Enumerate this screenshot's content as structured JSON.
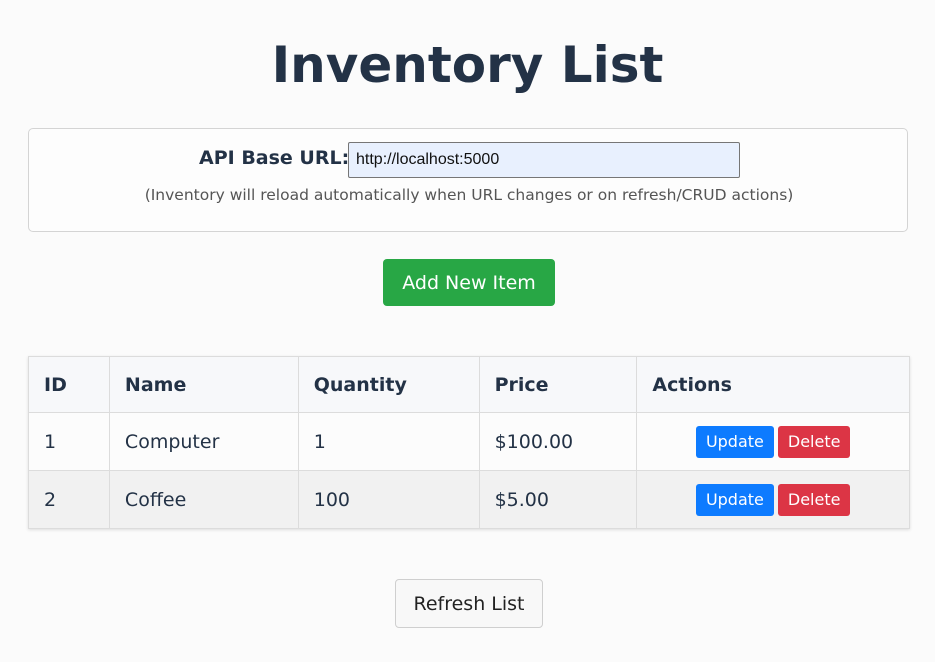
{
  "page": {
    "title": "Inventory List"
  },
  "config": {
    "label": "API Base URL:",
    "url_value": "http://localhost:5000",
    "hint": "(Inventory will reload automatically when URL changes or on refresh/CRUD actions)"
  },
  "actions": {
    "add_label": "Add New Item",
    "refresh_label": "Refresh List"
  },
  "table": {
    "headers": [
      "ID",
      "Name",
      "Quantity",
      "Price",
      "Actions"
    ],
    "rows": [
      {
        "id": "1",
        "name": "Computer",
        "quantity": "1",
        "price": "$100.00",
        "update_label": "Update",
        "delete_label": "Delete"
      },
      {
        "id": "2",
        "name": "Coffee",
        "quantity": "100",
        "price": "$5.00",
        "update_label": "Update",
        "delete_label": "Delete"
      }
    ]
  },
  "colors": {
    "add_button": "#28a745",
    "update_button": "#0d7bff",
    "delete_button": "#dc3545",
    "heading": "#233246"
  }
}
